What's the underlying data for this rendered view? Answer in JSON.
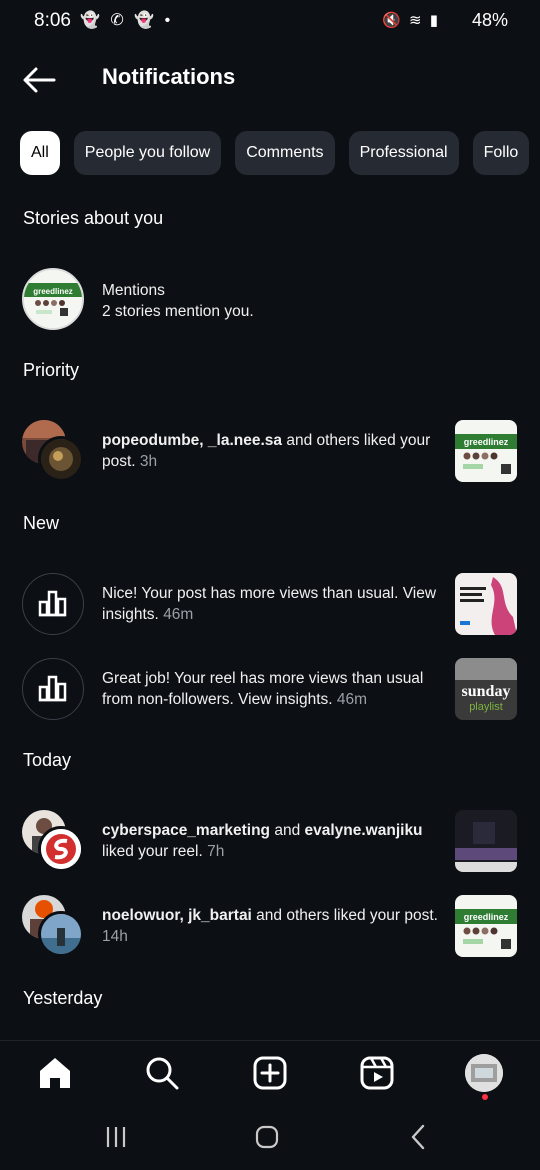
{
  "status_bar": {
    "time": "8:06",
    "left_icons": "👻 ✆ 👻 •",
    "battery": "48%"
  },
  "header": {
    "title": "Notifications"
  },
  "filters": [
    {
      "label": "All"
    },
    {
      "label": "People you follow"
    },
    {
      "label": "Comments"
    },
    {
      "label": "Professional"
    },
    {
      "label": "Follo"
    }
  ],
  "sections": {
    "stories": "Stories about you",
    "priority": "Priority",
    "new": "New",
    "today": "Today",
    "yesterday": "Yesterday"
  },
  "mentions": {
    "title": "Mentions",
    "subtitle": "2 stories mention you."
  },
  "priority_item": {
    "users": "popeodumbe, _la.nee.sa",
    "action": " and others liked your post.",
    "time": "3h"
  },
  "new_items": [
    {
      "text": "Nice! Your post has more views than usual. View insights.",
      "time": "46m"
    },
    {
      "text": "Great job! Your reel has more views than usual from non-followers. View insights.",
      "time": "46m"
    }
  ],
  "today_items": [
    {
      "user1": "cyberspace_marketing",
      "mid": " and ",
      "user2": "evalyne.wanjiku",
      "action": " liked your reel.",
      "time": "7h"
    },
    {
      "users": "noelowuor, jk_bartai",
      "action": " and others liked your post.",
      "time": "14h"
    }
  ],
  "thumbnails": {
    "greedlinez": "greedlinez",
    "sunday_top": "sunday",
    "sunday_bottom": "playlist"
  },
  "colors": {
    "background": "#0c0f14",
    "chip": "#262a33",
    "muted": "#9aa0a6",
    "notification_dot": "#ff3040"
  }
}
